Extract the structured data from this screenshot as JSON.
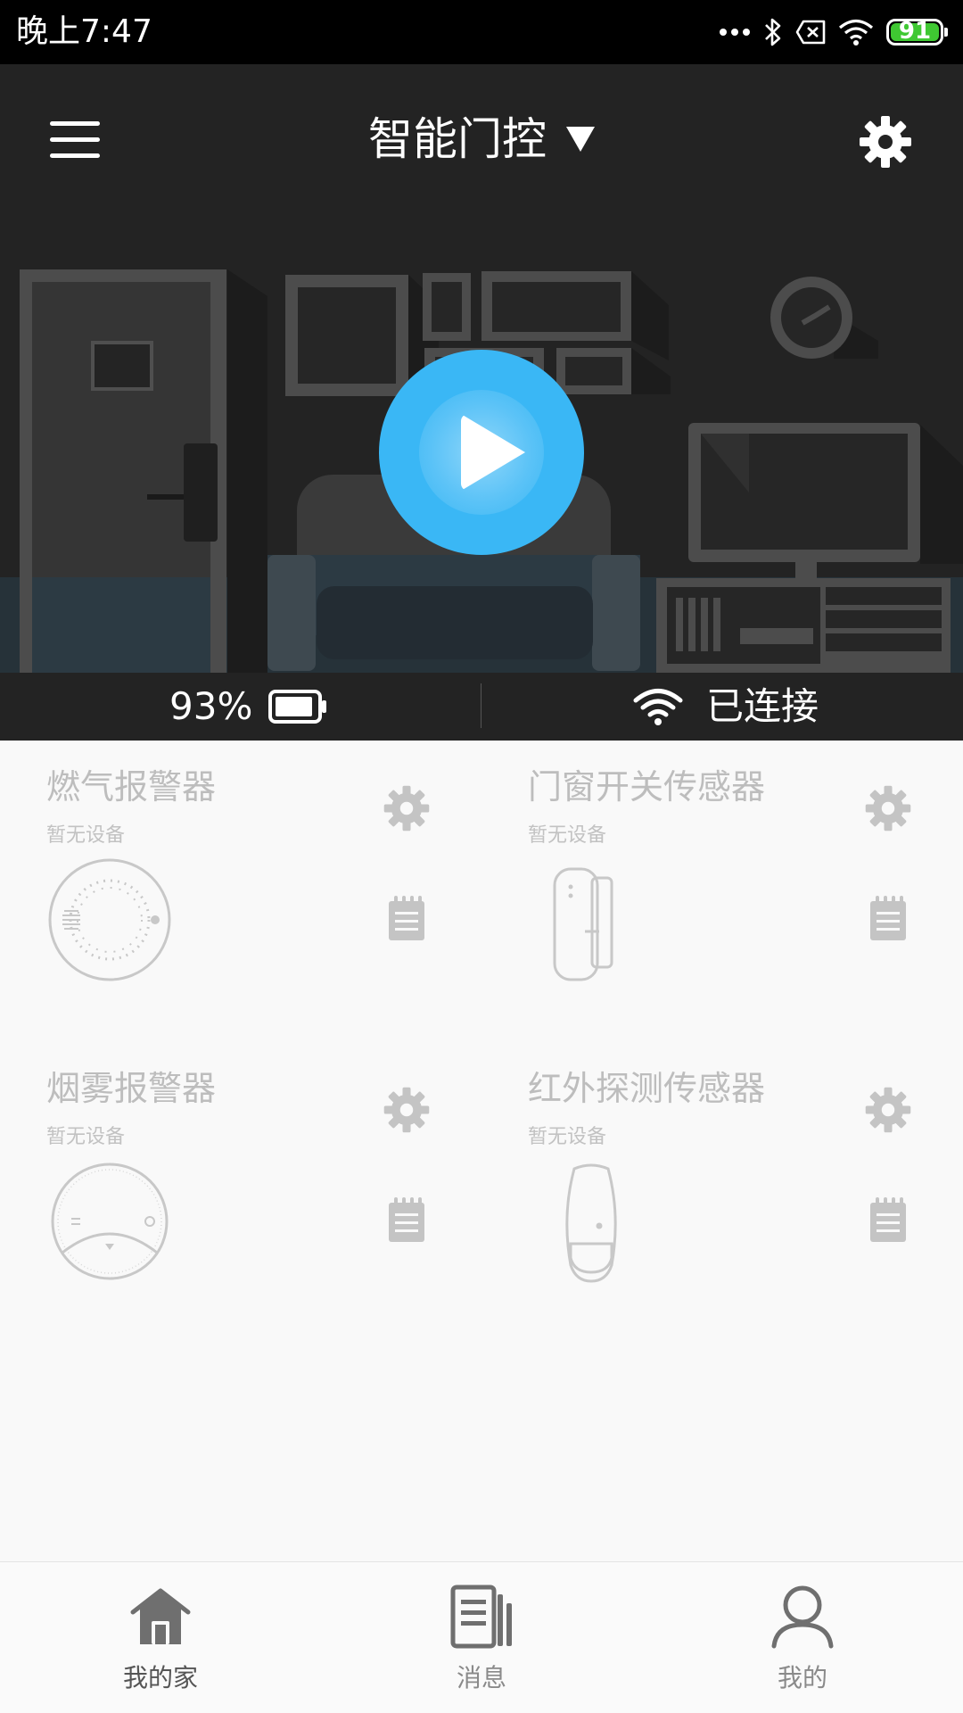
{
  "status_bar": {
    "time": "晚上7:47",
    "battery_level": "91",
    "icons": [
      "more-dots-icon",
      "bluetooth-icon",
      "sim-error-icon",
      "wifi-icon",
      "battery-icon"
    ]
  },
  "header": {
    "title": "智能门控",
    "menu_icon": "hamburger-menu-icon",
    "dropdown_icon": "caret-down-icon",
    "settings_icon": "gear-icon"
  },
  "hero": {
    "play_icon": "play-icon",
    "battery_percent": "93%",
    "battery_fraction": 0.93,
    "connection_status": "已连接"
  },
  "devices": [
    {
      "name": "燃气报警器",
      "status": "暂无设备",
      "icon": "gas-alarm-icon"
    },
    {
      "name": "门窗开关传感器",
      "status": "暂无设备",
      "icon": "door-window-sensor-icon"
    },
    {
      "name": "烟雾报警器",
      "status": "暂无设备",
      "icon": "smoke-alarm-icon"
    },
    {
      "name": "红外探测传感器",
      "status": "暂无设备",
      "icon": "infrared-sensor-icon"
    }
  ],
  "bottom_nav": {
    "items": [
      {
        "label": "我的家",
        "icon": "home-icon",
        "active": true
      },
      {
        "label": "消息",
        "icon": "message-icon",
        "active": false
      },
      {
        "label": "我的",
        "icon": "profile-icon",
        "active": false
      }
    ]
  },
  "colors": {
    "hero_background": "#232323",
    "play_button": "#3ab7f5",
    "battery_green": "#3fc832",
    "device_text": "#bdbdbd",
    "page_background": "#f9f9f9"
  }
}
